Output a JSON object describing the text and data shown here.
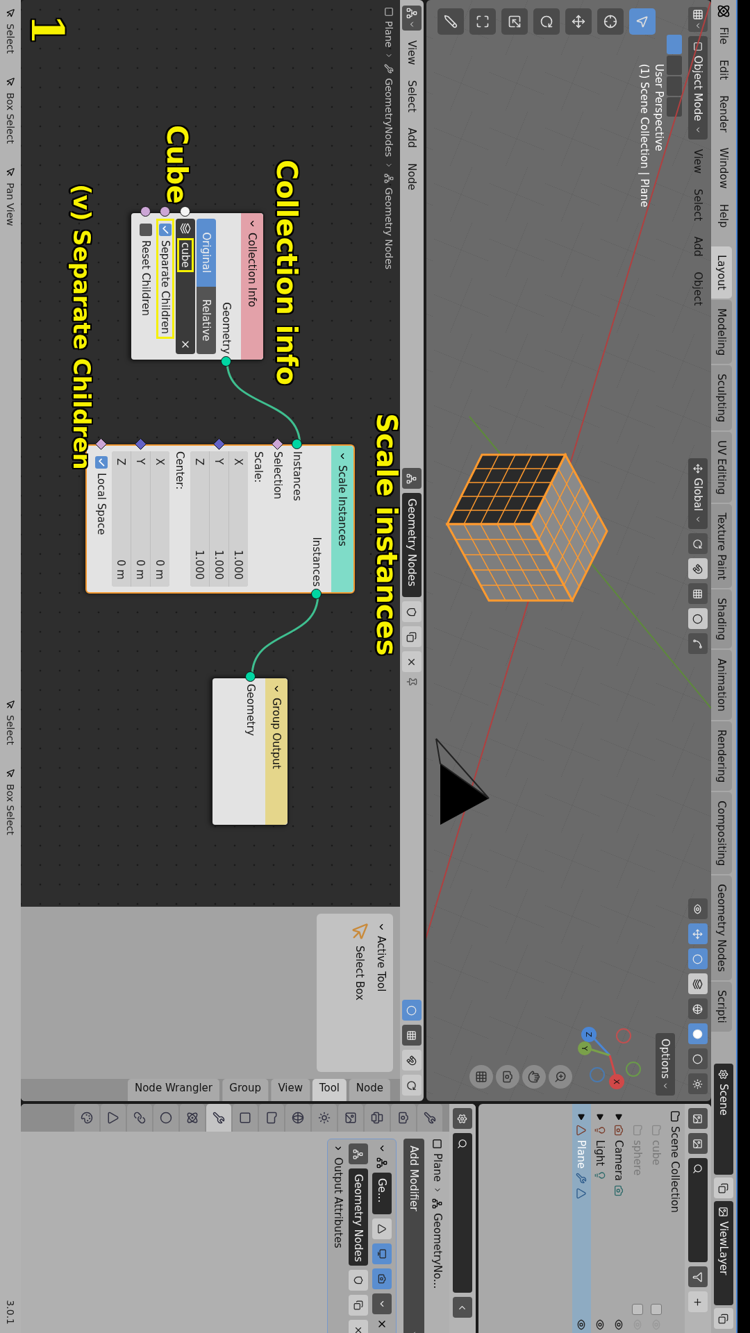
{
  "top_bar": {
    "menus": [
      "File",
      "Edit",
      "Render",
      "Window",
      "Help"
    ],
    "workspaces": [
      {
        "label": "Layout",
        "selected": true
      },
      {
        "label": "Modeling",
        "selected": false
      },
      {
        "label": "Sculpting",
        "selected": false
      },
      {
        "label": "UV Editing",
        "selected": false
      },
      {
        "label": "Texture Paint",
        "selected": false
      },
      {
        "label": "Shading",
        "selected": false
      },
      {
        "label": "Animation",
        "selected": false
      },
      {
        "label": "Rendering",
        "selected": false
      },
      {
        "label": "Compositing",
        "selected": false
      },
      {
        "label": "Geometry Nodes",
        "selected": false
      },
      {
        "label": "Scripti",
        "selected": false
      }
    ],
    "scene": "Scene",
    "view_layer": "ViewLayer"
  },
  "viewport": {
    "mode": "Object Mode",
    "menus": [
      "View",
      "Select",
      "Add",
      "Object"
    ],
    "orientation": "Global",
    "overlay_lines": [
      "User Perspective",
      "(1) Scene Collection | Plane"
    ],
    "options": "Options",
    "gizmo_axes": [
      "X",
      "Y",
      "Z"
    ]
  },
  "node_editor": {
    "menus": [
      "View",
      "Select",
      "Add",
      "Node"
    ],
    "node_tree": "Geometry Nodes",
    "breadcrumbs": [
      "Plane",
      "GeometryNodes",
      "Geometry Nodes"
    ],
    "nodes": [
      {
        "title": "Collection Info",
        "color": "#e3a1a9",
        "selected": false,
        "rows": [
          {
            "kind": "output",
            "label": "Geometry",
            "color": "#00d6a3",
            "diamond": false
          },
          {
            "kind": "toggle",
            "options": [
              {
                "label": "Original",
                "selected": true
              },
              {
                "label": "Relative",
                "selected": false
              }
            ]
          },
          {
            "kind": "field",
            "value": "cube",
            "color": "#f5f5f5",
            "diamond": false,
            "highlighted": true
          },
          {
            "kind": "checkbox",
            "label": "Separate Children",
            "checked": true,
            "color": "#cca6d6",
            "diamond": false,
            "highlighted": true
          },
          {
            "kind": "checkbox",
            "label": "Reset Children",
            "checked": false,
            "color": "#cca6d6",
            "diamond": false,
            "highlighted": false
          }
        ]
      },
      {
        "title": "Scale Instances",
        "color": "#7fdcc8",
        "selected": true,
        "rows": [
          {
            "kind": "output",
            "label": "Instances",
            "color": "#00d6a3",
            "diamond": false
          },
          {
            "kind": "input",
            "label": "Instances",
            "color": "#00d6a3",
            "diamond": false
          },
          {
            "kind": "input",
            "label": "Selection",
            "color": "#cca6d6",
            "diamond": true
          },
          {
            "kind": "label",
            "label": "Scale:"
          },
          {
            "kind": "vector",
            "color": "#6363c7",
            "diamond": true,
            "items": [
              {
                "axis": "X",
                "value": "1.000"
              },
              {
                "axis": "Y",
                "value": "1.000"
              },
              {
                "axis": "Z",
                "value": "1.000"
              }
            ]
          },
          {
            "kind": "label",
            "label": "Center:"
          },
          {
            "kind": "vector",
            "color": "#6363c7",
            "diamond": true,
            "items": [
              {
                "axis": "X",
                "value": "0 m"
              },
              {
                "axis": "Y",
                "value": "0 m"
              },
              {
                "axis": "Z",
                "value": "0 m"
              }
            ]
          },
          {
            "kind": "checkbox",
            "label": "Local Space",
            "checked": true,
            "color": "#cca6d6",
            "diamond": true,
            "highlighted": false
          }
        ]
      },
      {
        "title": "Group Output",
        "color": "#e5d68b",
        "selected": false,
        "rows": [
          {
            "kind": "input",
            "label": "Geometry",
            "color": "#00d6a3",
            "diamond": false
          }
        ]
      }
    ],
    "annotations": [
      "Collection info",
      "Scale instances",
      "Cube",
      "(v) Separate Children",
      "1"
    ],
    "sidebar": {
      "panel": "Active Tool",
      "tool": "Select Box",
      "tabs": [
        {
          "label": "Node Wrangler",
          "selected": false
        },
        {
          "label": "Group",
          "selected": false
        },
        {
          "label": "View",
          "selected": false
        },
        {
          "label": "Tool",
          "selected": true
        },
        {
          "label": "Node",
          "selected": false
        }
      ]
    }
  },
  "outliner": {
    "root": "Scene Collection",
    "items": [
      {
        "name": "cube",
        "kind": "collection",
        "excluded": true,
        "selected": false
      },
      {
        "name": "sphere",
        "kind": "collection",
        "excluded": true,
        "selected": false
      },
      {
        "name": "Camera",
        "kind": "camera",
        "excluded": false,
        "selected": false
      },
      {
        "name": "Light",
        "kind": "light",
        "excluded": false,
        "selected": false
      },
      {
        "name": "Plane",
        "kind": "mesh",
        "excluded": false,
        "selected": true
      }
    ]
  },
  "properties": {
    "tabs": [
      {
        "selected": false
      },
      {
        "selected": false
      },
      {
        "selected": false
      },
      {
        "selected": false
      },
      {
        "selected": false
      },
      {
        "selected": false
      },
      {
        "selected": false
      },
      {
        "selected": false
      },
      {
        "selected": true
      },
      {
        "selected": false
      },
      {
        "selected": false
      },
      {
        "selected": false
      },
      {
        "selected": false
      },
      {
        "selected": false
      }
    ],
    "breadcrumbs": [
      "Plane",
      "GeometryNo..."
    ],
    "add_modifier": "Add Modifier",
    "modifier": {
      "name": "Ge...",
      "node_group": "Geometry Nodes",
      "subpanel": "Output Attributes"
    }
  },
  "status_bar": {
    "groups": [
      [
        "Select",
        "Box Select",
        "Pan View"
      ],
      [
        "Select",
        "Box Select"
      ]
    ],
    "version": "3.0.1"
  }
}
